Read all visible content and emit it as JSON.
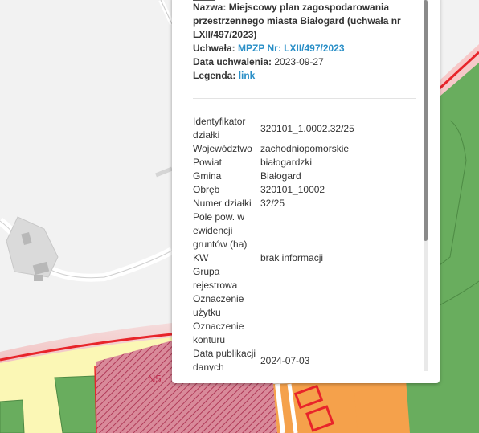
{
  "popup": {
    "plan": {
      "name_label": "Nazwa:",
      "name_value": "Miejscowy plan zagospodarowania przestrzennego miasta Białogard (uchwała nr LXII/497/2023)",
      "resolution_label": "Uchwała:",
      "resolution_link": "MPZP Nr: LXII/497/2023",
      "date_label": "Data uchwalenia:",
      "date_value": "2023-09-27",
      "legend_label": "Legenda:",
      "legend_link": "link"
    },
    "attributes": [
      {
        "key": "Identyfikator działki",
        "value": "320101_1.0002.32/25"
      },
      {
        "key": "Województwo",
        "value": "zachodniopomorskie"
      },
      {
        "key": "Powiat",
        "value": "białogardzki"
      },
      {
        "key": "Gmina",
        "value": "Białogard"
      },
      {
        "key": "Obręb",
        "value": "320101_10002"
      },
      {
        "key": "Numer działki",
        "value": "32/25"
      },
      {
        "key": "Pole pow. w ewidencji gruntów (ha)",
        "value": ""
      },
      {
        "key": "KW",
        "value": "brak informacji"
      },
      {
        "key": "Grupa rejestrowa",
        "value": ""
      },
      {
        "key": "Oznaczenie użytku",
        "value": ""
      },
      {
        "key": "Oznaczenie konturu",
        "value": ""
      },
      {
        "key": "Data publikacji danych",
        "value": "2024-07-03"
      }
    ]
  },
  "map": {
    "zone_label": "N5",
    "colors": {
      "background": "#f2f2f2",
      "green_zone": "#69ad5e",
      "yellow_zone": "#fbf7b5",
      "orange_zone": "#f5a14b",
      "red_boundary": "#e8242a",
      "pink_hatch": "#c8536e"
    }
  }
}
